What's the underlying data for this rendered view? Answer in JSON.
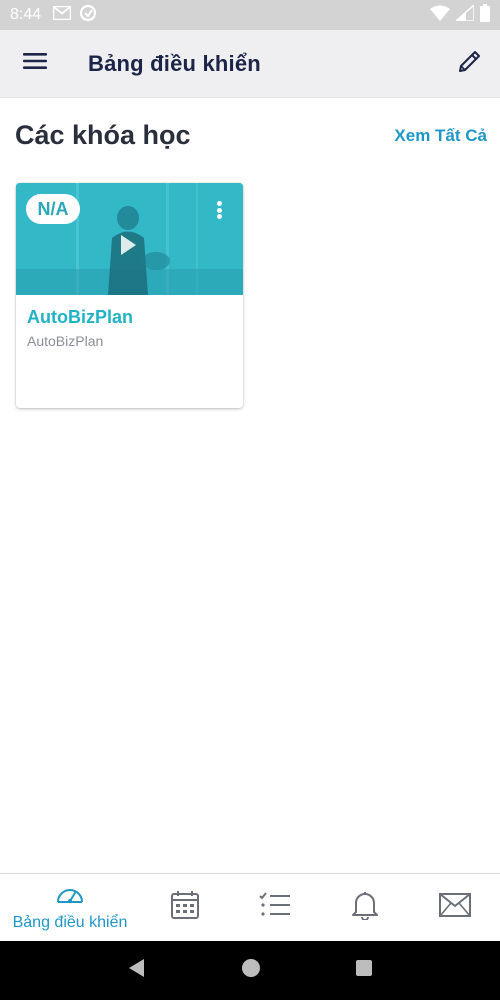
{
  "status_bar": {
    "time": "8:44",
    "icons_left": [
      "gmail-icon",
      "data-saver-icon"
    ],
    "icons_right": [
      "wifi-icon",
      "signal-icon",
      "battery-icon"
    ]
  },
  "app_bar": {
    "title": "Bảng điều khiển",
    "menu_icon": "hamburger-menu-icon",
    "edit_icon": "pencil-icon"
  },
  "courses_section": {
    "title": "Các khóa học",
    "see_all_label": "Xem Tất Cả"
  },
  "courses": [
    {
      "progress_badge": "N/A",
      "title": "AutoBizPlan",
      "subtitle": "AutoBizPlan",
      "image_color": "#2fb4c4"
    }
  ],
  "bottom_nav": {
    "items": [
      {
        "label": "Bảng điều khiển",
        "icon": "dashboard-gauge-icon",
        "active": true
      },
      {
        "label": "",
        "icon": "calendar-icon",
        "active": false
      },
      {
        "label": "",
        "icon": "checklist-icon",
        "active": false
      },
      {
        "label": "",
        "icon": "bell-icon",
        "active": false
      },
      {
        "label": "",
        "icon": "envelope-icon",
        "active": false
      }
    ]
  },
  "colors": {
    "accent": "#1f97c6",
    "course_title": "#21b3c5",
    "header_bg": "#efeff1",
    "title_text": "#1c2447"
  }
}
